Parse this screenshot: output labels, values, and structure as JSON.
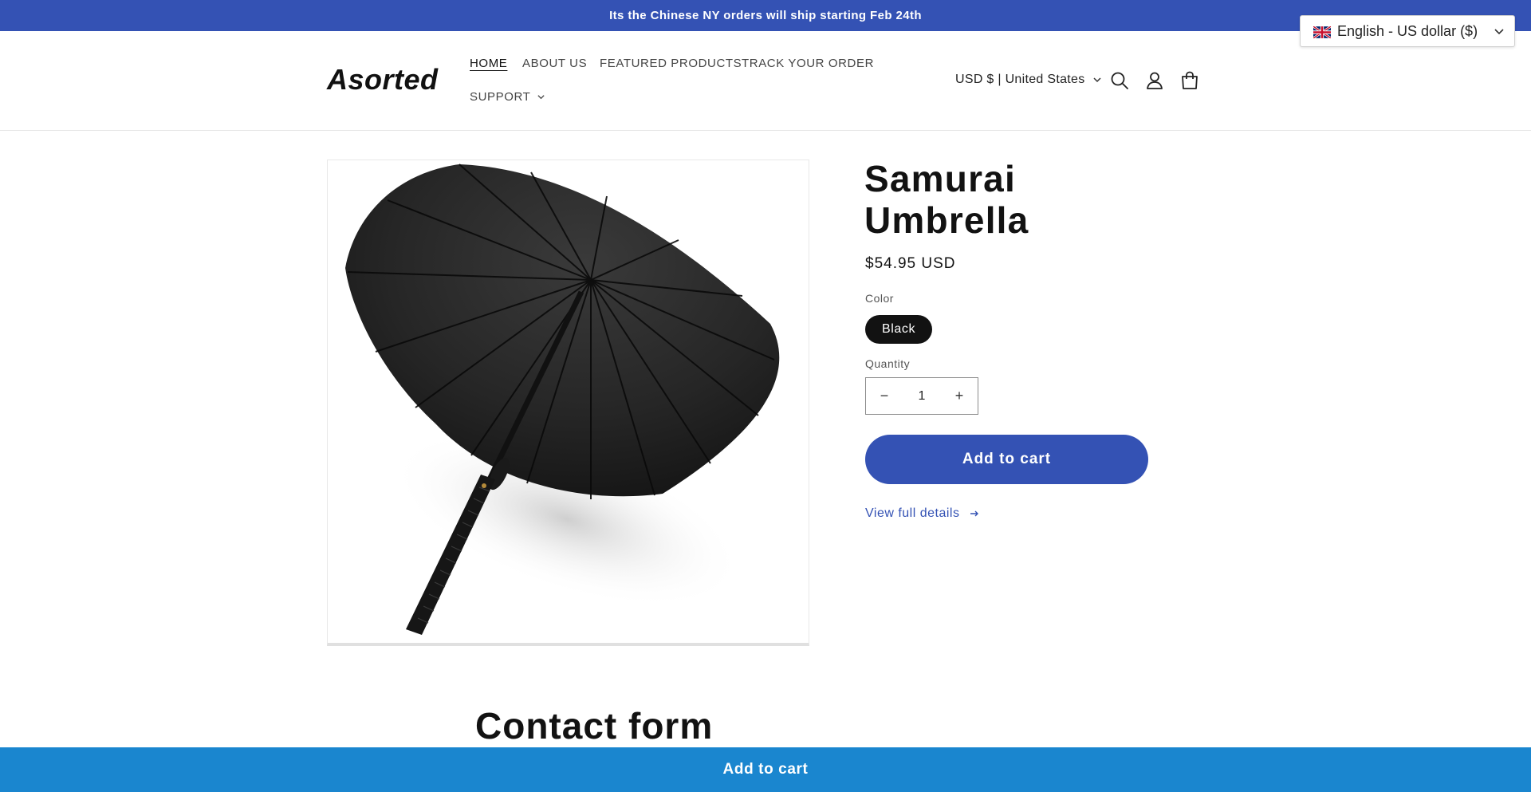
{
  "announcement": {
    "text": "Its the Chinese NY orders will ship starting Feb 24th"
  },
  "language_switcher": {
    "label": "English - US dollar ($)",
    "flag": "uk-flag-icon"
  },
  "header": {
    "logo": "Asorted",
    "nav": [
      {
        "label": "HOME",
        "active": true
      },
      {
        "label": "ABOUT US"
      },
      {
        "label": "FEATURED PRODUCTS"
      },
      {
        "label": "TRACK YOUR ORDER"
      },
      {
        "label": "SUPPORT",
        "has_dropdown": true
      }
    ],
    "currency": "USD $ | United States",
    "icons": [
      "search-icon",
      "account-icon",
      "cart-icon"
    ]
  },
  "product": {
    "image_alt": "Black samurai umbrella with katana handle",
    "title": "Samurai Umbrella",
    "price": "$54.95 USD",
    "color_label": "Color",
    "color_selected": "Black",
    "quantity_label": "Quantity",
    "quantity_value": "1",
    "quantity_decrease": "−",
    "quantity_increase": "+",
    "add_to_cart": "Add to cart",
    "view_details": "View full details"
  },
  "contact": {
    "title": "Contact form"
  },
  "sticky_bar": {
    "label": "Add to cart"
  },
  "colors": {
    "accent": "#3452b4",
    "sticky": "#1a86cf",
    "text": "#121212"
  }
}
